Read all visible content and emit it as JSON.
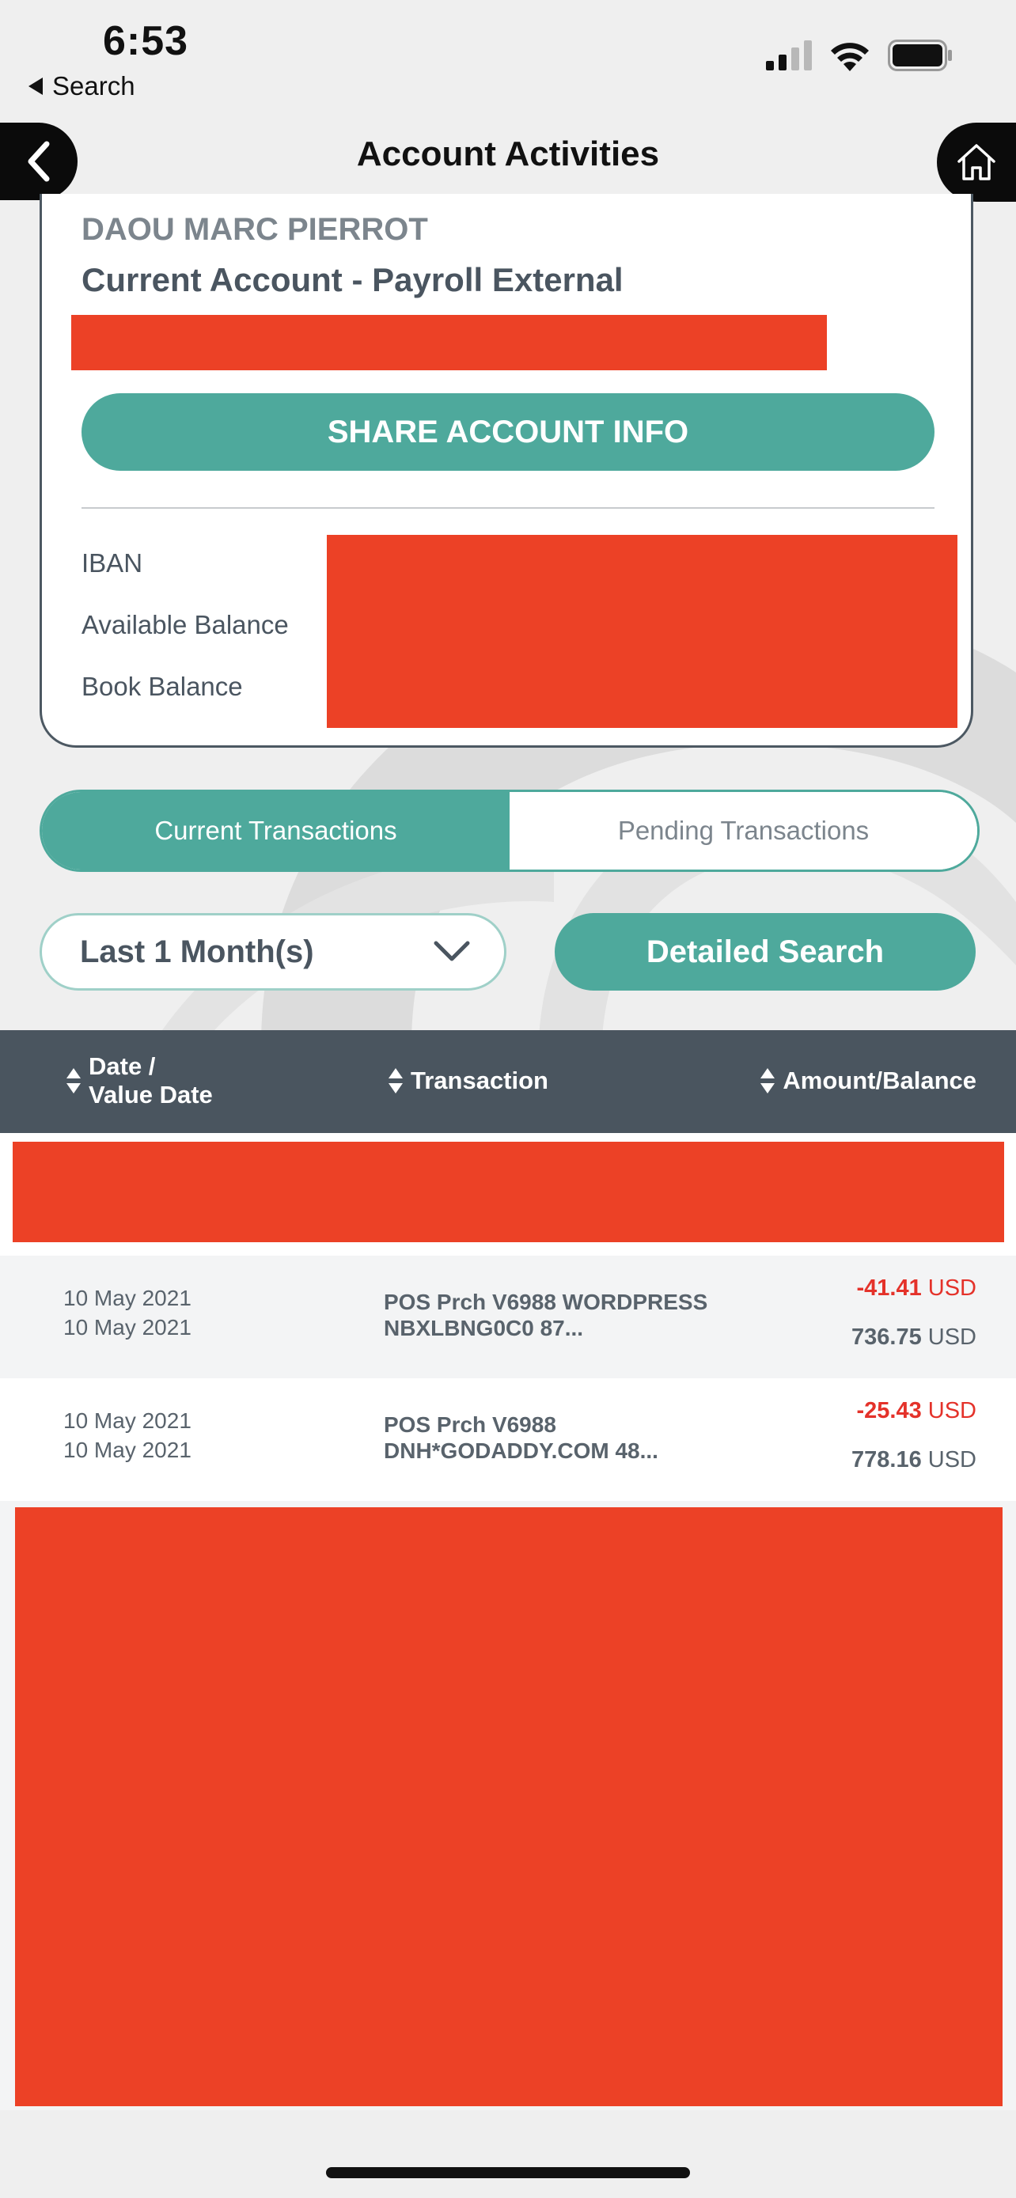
{
  "status_bar": {
    "time": "6:53",
    "back_label": "Search",
    "icons": [
      "signal-icon",
      "wifi-icon",
      "battery-icon"
    ]
  },
  "header": {
    "title": "Account Activities",
    "back_icon": "chevron-left-icon",
    "home_icon": "home-icon"
  },
  "account": {
    "holder_name": "DAOU MARC PIERROT",
    "account_type": "Current Account - Payroll External",
    "share_button": "SHARE ACCOUNT INFO",
    "fields": [
      "IBAN",
      "Available Balance",
      "Book Balance"
    ]
  },
  "tabs": [
    {
      "label": "Current Transactions",
      "active": true
    },
    {
      "label": "Pending Transactions",
      "active": false
    }
  ],
  "filters": {
    "period_value": "Last 1 Month(s)",
    "detailed_search": "Detailed Search"
  },
  "table": {
    "columns": [
      {
        "label_line1": "Date /",
        "label_line2": "Value Date"
      },
      {
        "label_line1": "Transaction",
        "label_line2": ""
      },
      {
        "label_line1": "Amount/Balance",
        "label_line2": ""
      }
    ],
    "rows": [
      {
        "date": "10 May 2021",
        "value_date": "10 May 2021",
        "desc_line1": "POS Prch V6988 WORDPRESS",
        "desc_line2": "NBXLBNG0C0 87...",
        "amount": "-41.41",
        "amount_currency": "USD",
        "balance": "736.75",
        "balance_currency": "USD"
      },
      {
        "date": "10 May 2021",
        "value_date": "10 May 2021",
        "desc_line1": "POS Prch V6988",
        "desc_line2": "DNH*GODADDY.COM 48...",
        "amount": "-25.43",
        "amount_currency": "USD",
        "balance": "778.16",
        "balance_currency": "USD"
      }
    ]
  },
  "colors": {
    "accent": "#4ea99c",
    "header_bg": "#4a555f",
    "redaction": "#ec4126",
    "negative": "#e4322a"
  }
}
